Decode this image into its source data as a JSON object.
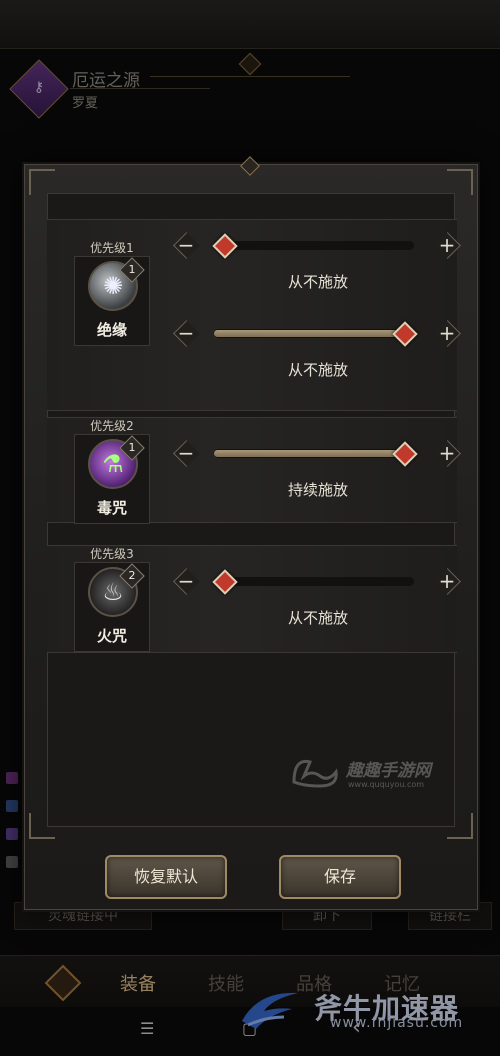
{
  "header": {
    "title": "厄运之源",
    "subtitle": "罗夏"
  },
  "background": {
    "bottom_left_button": "灵魂链接中",
    "bottom_mid_button": "卸下",
    "bottom_right_button": "链接栏"
  },
  "bottom_nav": {
    "tabs": [
      "装备",
      "技能",
      "品格",
      "记忆"
    ],
    "active_tab": "装备"
  },
  "dialog": {
    "groups": [
      {
        "priority_label": "优先级1",
        "skill_name": "绝缘",
        "level": "1",
        "icon": "wolf-skill-icon",
        "sliders": [
          {
            "value": 0,
            "mode": "从不施放"
          },
          {
            "value": 1,
            "mode": "从不施放"
          }
        ]
      },
      {
        "priority_label": "优先级2",
        "skill_name": "毒咒",
        "level": "1",
        "icon": "poison-skill-icon",
        "sliders": [
          {
            "value": 1,
            "mode": "持续施放"
          }
        ]
      },
      {
        "priority_label": "优先级3",
        "skill_name": "火咒",
        "level": "2",
        "icon": "fire-skill-icon",
        "sliders": [
          {
            "value": 0,
            "mode": "从不施放"
          }
        ]
      }
    ],
    "reset_button": "恢复默认",
    "save_button": "保存"
  },
  "watermarks": {
    "center_text": "趣趣手游网",
    "center_url": "www.ququyou.com",
    "brand_text": "斧牛加速器",
    "brand_url": "www.fnjiasu.com"
  },
  "system_nav": {
    "menu": "☰",
    "home": "▢",
    "back": "‹"
  },
  "colors": {
    "knob": "#c0392b",
    "button_border": "#a08a64",
    "active_tab": "#e9c590"
  }
}
